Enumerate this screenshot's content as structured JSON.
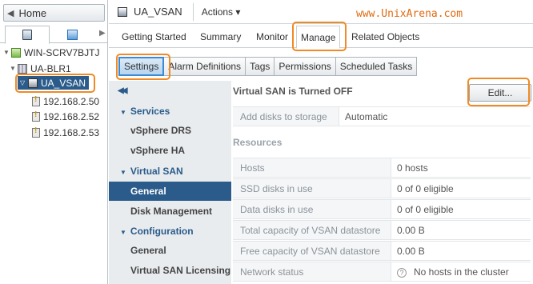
{
  "navigator": {
    "home_label": "Home",
    "tree": [
      {
        "label": "WIN-SCRV7BJTJ",
        "icon": "vcenter-icon"
      },
      {
        "label": "UA-BLR1",
        "icon": "datacenter-icon"
      },
      {
        "label": "UA_VSAN",
        "icon": "cluster-icon"
      },
      {
        "label": "192.168.2.50",
        "icon": "host-warning-icon"
      },
      {
        "label": "192.168.2.52",
        "icon": "host-warning-icon"
      },
      {
        "label": "192.168.2.53",
        "icon": "host-warning-icon"
      }
    ]
  },
  "object": {
    "title": "UA_VSAN",
    "actions_label": "Actions ▾"
  },
  "watermark": "www.UnixArena.com",
  "main_tabs": [
    "Getting Started",
    "Summary",
    "Monitor",
    "Manage",
    "Related Objects"
  ],
  "sub_tabs": [
    "Settings",
    "Alarm Definitions",
    "Tags",
    "Permissions",
    "Scheduled Tasks"
  ],
  "settings_nav": {
    "collapse_glyph": "◀◀",
    "groups": [
      {
        "label": "Services",
        "items": [
          "vSphere DRS",
          "vSphere HA"
        ]
      },
      {
        "label": "Virtual SAN",
        "items": [
          "General",
          "Disk Management"
        ]
      },
      {
        "label": "Configuration",
        "items": [
          "General",
          "Virtual SAN Licensing"
        ]
      }
    ]
  },
  "content": {
    "status_title": "Virtual SAN is Turned OFF",
    "edit_label": "Edit...",
    "add_disks": {
      "key": "Add disks to storage",
      "value": "Automatic"
    },
    "resources_title": "Resources",
    "resources": [
      {
        "key": "Hosts",
        "value": "0 hosts"
      },
      {
        "key": "SSD disks in use",
        "value": "0 of 0 eligible"
      },
      {
        "key": "Data disks in use",
        "value": "0 of 0 eligible"
      },
      {
        "key": "Total capacity of VSAN datastore",
        "value": "0.00 B"
      },
      {
        "key": "Free capacity of VSAN datastore",
        "value": "0.00 B"
      },
      {
        "key": "Network status",
        "value": "No hosts in the cluster"
      }
    ]
  },
  "colors": {
    "highlight": "#f08a24",
    "selection": "#2a5b8a",
    "watermark": "#e06a10"
  }
}
